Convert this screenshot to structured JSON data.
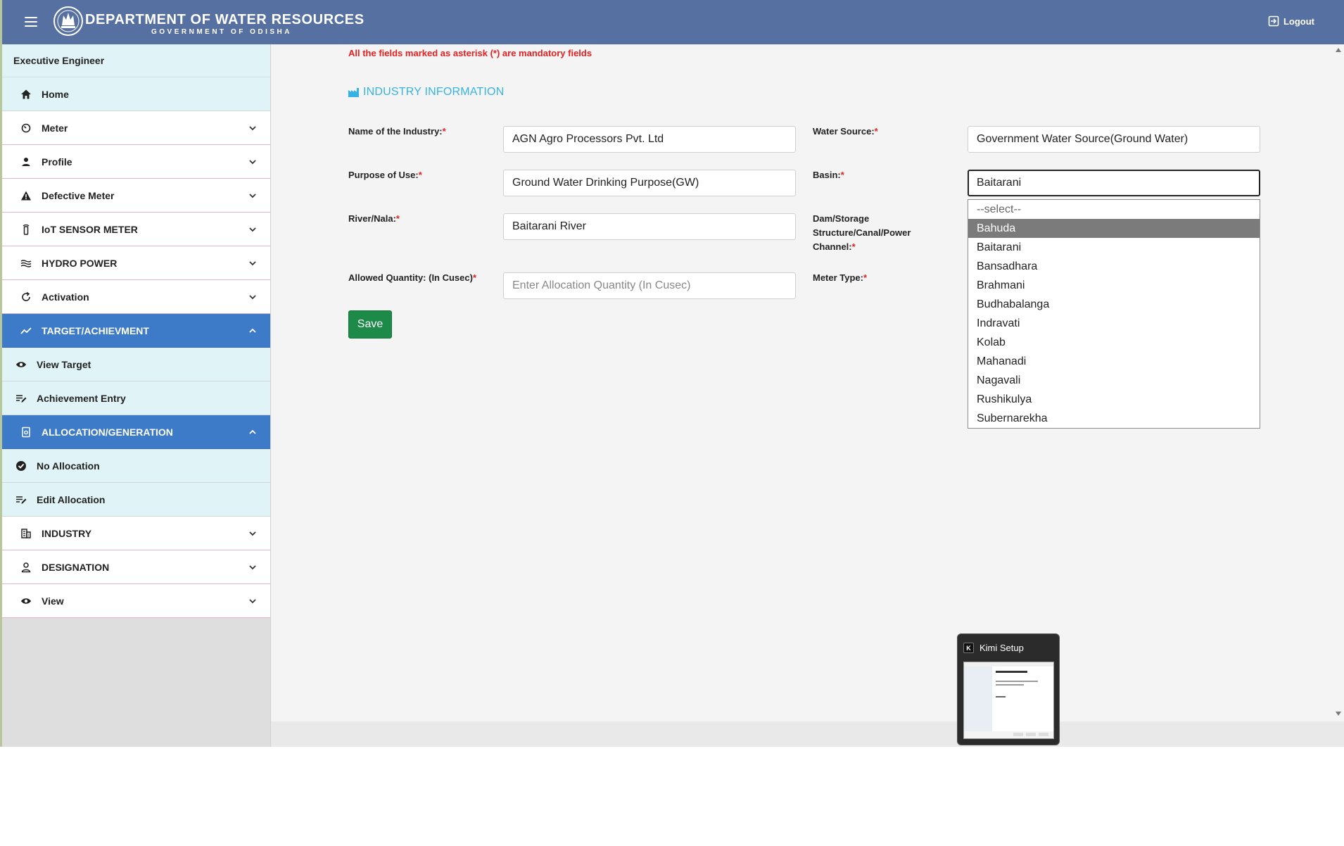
{
  "header": {
    "title": "DEPARTMENT OF WATER RESOURCES",
    "subtitle": "GOVERNMENT OF ODISHA",
    "logout_label": "Logout"
  },
  "sidebar": {
    "user_role": "Executive Engineer",
    "items": [
      {
        "label": "Home",
        "icon": "home-icon"
      },
      {
        "label": "Meter",
        "icon": "gauge-icon"
      },
      {
        "label": "Profile",
        "icon": "person-icon"
      },
      {
        "label": "Defective Meter",
        "icon": "warning-icon"
      },
      {
        "label": "IoT SENSOR METER",
        "icon": "sensor-icon"
      },
      {
        "label": "HYDRO POWER",
        "icon": "waves-icon"
      },
      {
        "label": "Activation",
        "icon": "refresh-icon"
      },
      {
        "label": "TARGET/ACHIEVMENT",
        "icon": "trend-icon"
      },
      {
        "label": "View Target",
        "icon": "eye-icon"
      },
      {
        "label": "Achievement Entry",
        "icon": "edit-list-icon"
      },
      {
        "label": "ALLOCATION/GENERATION",
        "icon": "document-icon"
      },
      {
        "label": "No Allocation",
        "icon": "check-circle-icon"
      },
      {
        "label": "Edit Allocation",
        "icon": "edit-list-icon"
      },
      {
        "label": "INDUSTRY",
        "icon": "building-icon"
      },
      {
        "label": "DESIGNATION",
        "icon": "person-outline-icon"
      },
      {
        "label": "View",
        "icon": "eye-icon"
      }
    ]
  },
  "form": {
    "mandatory_note": "All the fields marked as asterisk (*) are mandatory fields",
    "section_title": "INDUSTRY INFORMATION",
    "required_mark": "*",
    "fields": {
      "industry_name": {
        "label": "Name of the Industry:",
        "value": "AGN Agro Processors Pvt. Ltd"
      },
      "water_source": {
        "label": "Water Source:",
        "value": "Government Water Source(Ground Water)"
      },
      "purpose": {
        "label": "Purpose of Use:",
        "value": "Ground Water Drinking Purpose(GW)"
      },
      "basin": {
        "label": "Basin:",
        "value": "Baitarani"
      },
      "river": {
        "label": "River/Nala:",
        "value": "Baitarani River"
      },
      "dam": {
        "label": "Dam/Storage Structure/Canal/Power Channel:"
      },
      "quantity": {
        "label": "Allowed Quantity: (In Cusec)",
        "placeholder": "Enter Allocation Quantity (In Cusec)"
      },
      "meter_type": {
        "label": "Meter Type:"
      }
    },
    "save_label": "Save"
  },
  "basin_dropdown": {
    "options": [
      "--select--",
      "Bahuda",
      "Baitarani",
      "Bansadhara",
      "Brahmani",
      "Budhabalanga",
      "Indravati",
      "Kolab",
      "Mahanadi",
      "Nagavali",
      "Rushikulya",
      "Subernarekha"
    ],
    "highlighted": "Bahuda"
  },
  "taskbar_preview": {
    "title": "Kimi Setup",
    "logo_letter": "K"
  },
  "colors": {
    "header_bg": "#5570a1",
    "active_bg": "#3d7ac8",
    "accent_cyan": "#36b3e4",
    "required_red": "#ea1e1e",
    "save_green": "#1e8a4a"
  }
}
